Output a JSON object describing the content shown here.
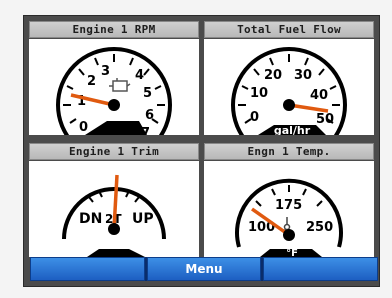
{
  "gauges": {
    "rpm": {
      "title": "Engine 1 RPM",
      "ticks": [
        "0",
        "1",
        "2",
        "3",
        "4",
        "5",
        "6",
        "7"
      ],
      "icon": "engine-icon",
      "needle_value": 1.0,
      "needle_color": "#e05a10"
    },
    "fuel": {
      "title": "Total Fuel Flow",
      "ticks": [
        "0",
        "10",
        "20",
        "30",
        "40",
        "50"
      ],
      "unit": "gal/hr",
      "needle_value": 48,
      "needle_color": "#e05a10"
    },
    "trim": {
      "title": "Engine 1 Trim",
      "left_label": "DN",
      "right_label": "UP",
      "needle_value": 0.1,
      "needle_color": "#e05a10"
    },
    "temp": {
      "title": "Engn 1 Temp.",
      "ticks": [
        "100",
        "175",
        "250"
      ],
      "unit": "°F",
      "icon": "thermometer-icon",
      "needle_value": 100,
      "needle_color": "#e05a10"
    }
  },
  "menu": {
    "center_label": "Menu",
    "button_color": "#2b78d8"
  }
}
